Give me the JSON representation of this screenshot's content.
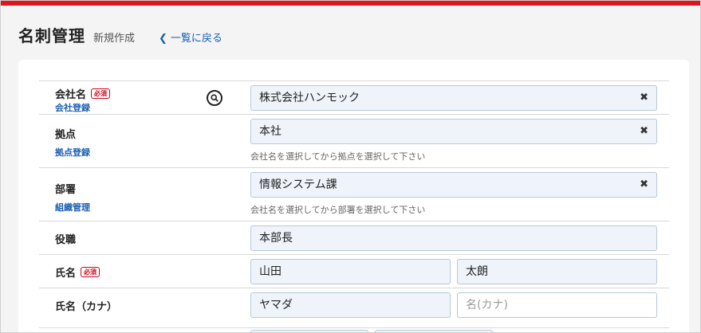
{
  "header": {
    "title": "名刺管理",
    "subtitle": "新規作成",
    "back_label": "一覧に戻る"
  },
  "form": {
    "company": {
      "label": "会社名",
      "required_badge": "必須",
      "link": "会社登録",
      "value": "株式会社ハンモック"
    },
    "base": {
      "label": "拠点",
      "link": "拠点登録",
      "value": "本社",
      "hint": "会社名を選択してから拠点を選択して下さい"
    },
    "department": {
      "label": "部署",
      "link": "組織管理",
      "value": "情報システム課",
      "hint": "会社名を選択してから部署を選択して下さい"
    },
    "position": {
      "label": "役職",
      "value": "本部長"
    },
    "name": {
      "label": "氏名",
      "required_badge": "必須",
      "last": "山田",
      "first": "太朗"
    },
    "name_kana": {
      "label": "氏名（カナ）",
      "last": "ヤマダ",
      "first_placeholder": "名(カナ)"
    }
  },
  "icons": {
    "back": "chevron-left-icon",
    "search": "search-icon",
    "clear": "close-icon"
  },
  "colors": {
    "accent_bar": "#e0141e",
    "link": "#1a5fb4",
    "required": "#d0021b",
    "input_bg": "#eef4fa"
  }
}
